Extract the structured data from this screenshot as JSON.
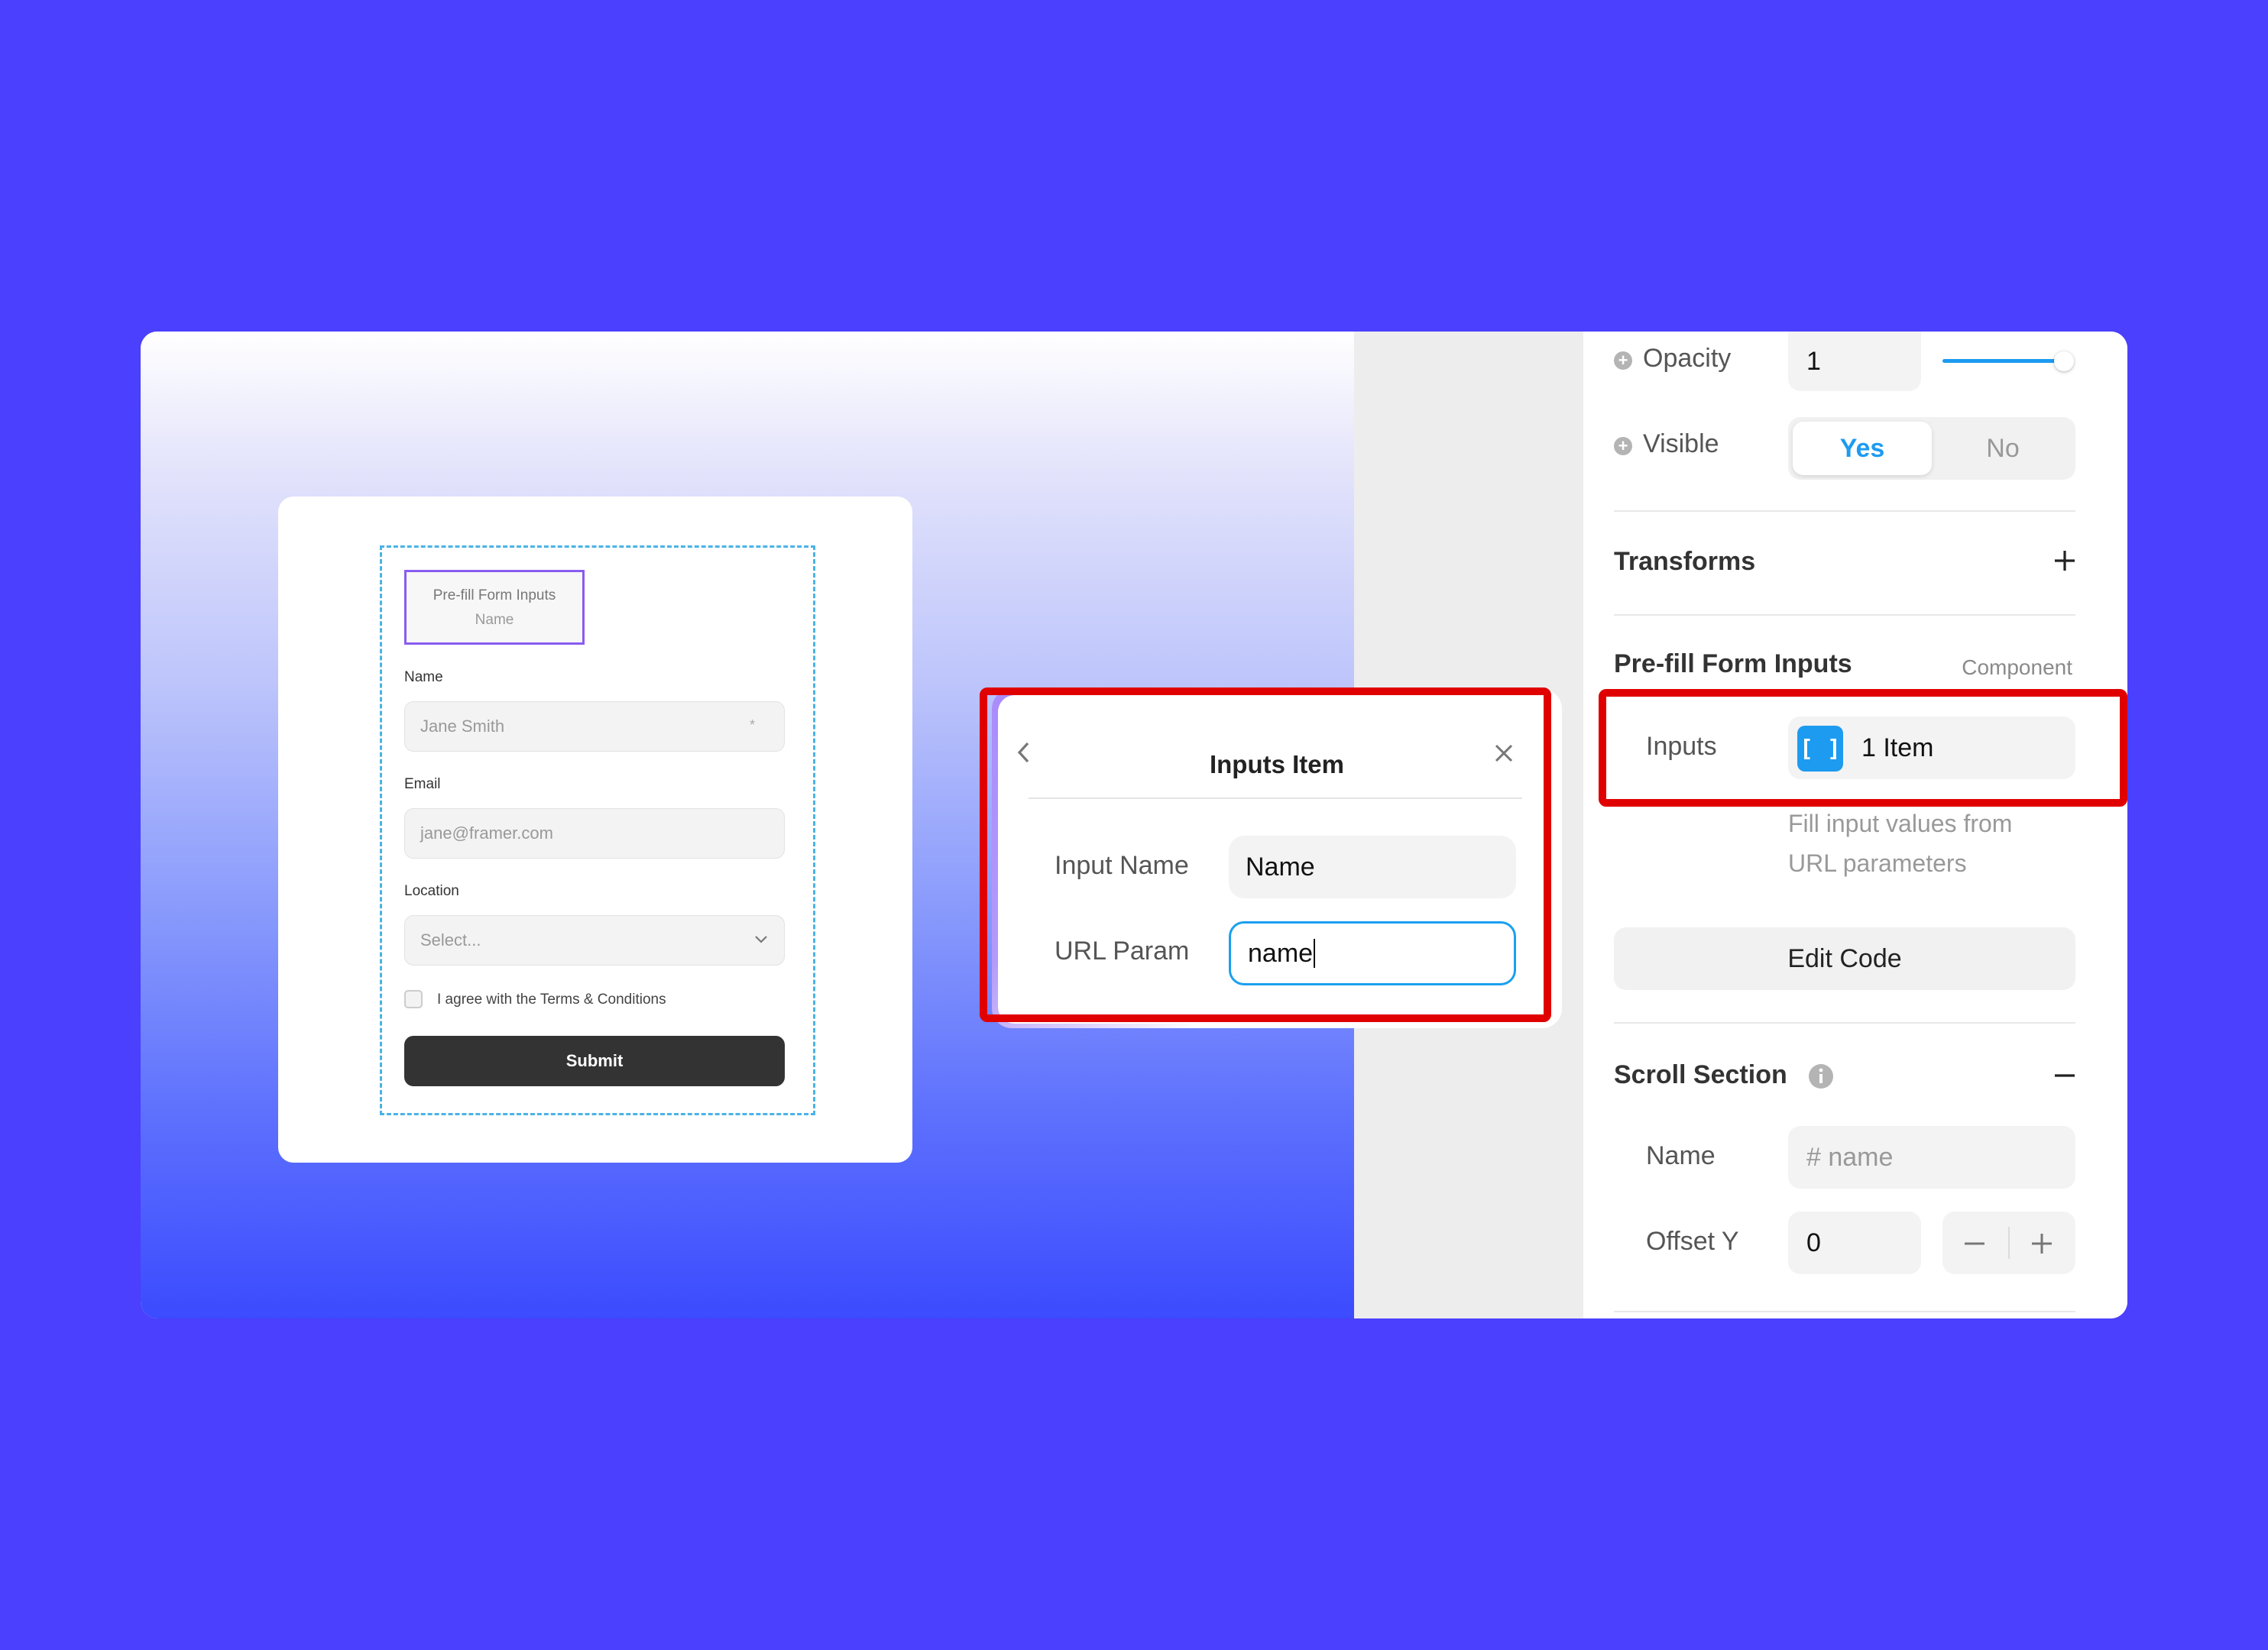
{
  "form_preview": {
    "component_title": "Pre-fill Form Inputs",
    "component_subtitle": "Name",
    "name_label": "Name",
    "name_placeholder": "Jane Smith",
    "name_required_mark": "*",
    "email_label": "Email",
    "email_placeholder": "jane@framer.com",
    "location_label": "Location",
    "location_placeholder": "Select...",
    "terms_label": "I agree with the Terms & Conditions",
    "submit_label": "Submit"
  },
  "popover": {
    "title": "Inputs Item",
    "input_name_label": "Input Name",
    "input_name_value": "Name",
    "url_param_label": "URL Param",
    "url_param_value": "name"
  },
  "panel": {
    "opacity_label": "Opacity",
    "opacity_value": "1",
    "opacity_slider_fraction": 1.0,
    "visible_label": "Visible",
    "visible_yes": "Yes",
    "visible_no": "No",
    "visible_selected": "Yes",
    "transforms_label": "Transforms",
    "component_name": "Pre-fill Form Inputs",
    "component_tag": "Component",
    "inputs_label": "Inputs",
    "inputs_badge": "[ ]",
    "inputs_value": "1 Item",
    "inputs_description_line1": "Fill input values from",
    "inputs_description_line2": "URL parameters",
    "edit_code_label": "Edit Code",
    "scroll_section_label": "Scroll Section",
    "scroll_name_label": "Name",
    "scroll_name_placeholder": "# name",
    "offset_y_label": "Offset Y",
    "offset_y_value": "0"
  },
  "colors": {
    "background": "#4a40fd",
    "accent_blue": "#1d9bf0",
    "highlight_red": "#e00000",
    "selection_purple": "#8a5cf0",
    "frame_dashed": "#4ab3e6"
  },
  "icons": [
    "plus-circle-icon",
    "plus-icon",
    "minus-icon",
    "info-icon",
    "chevron-left-icon",
    "close-icon",
    "chevron-down-icon",
    "array-icon"
  ]
}
